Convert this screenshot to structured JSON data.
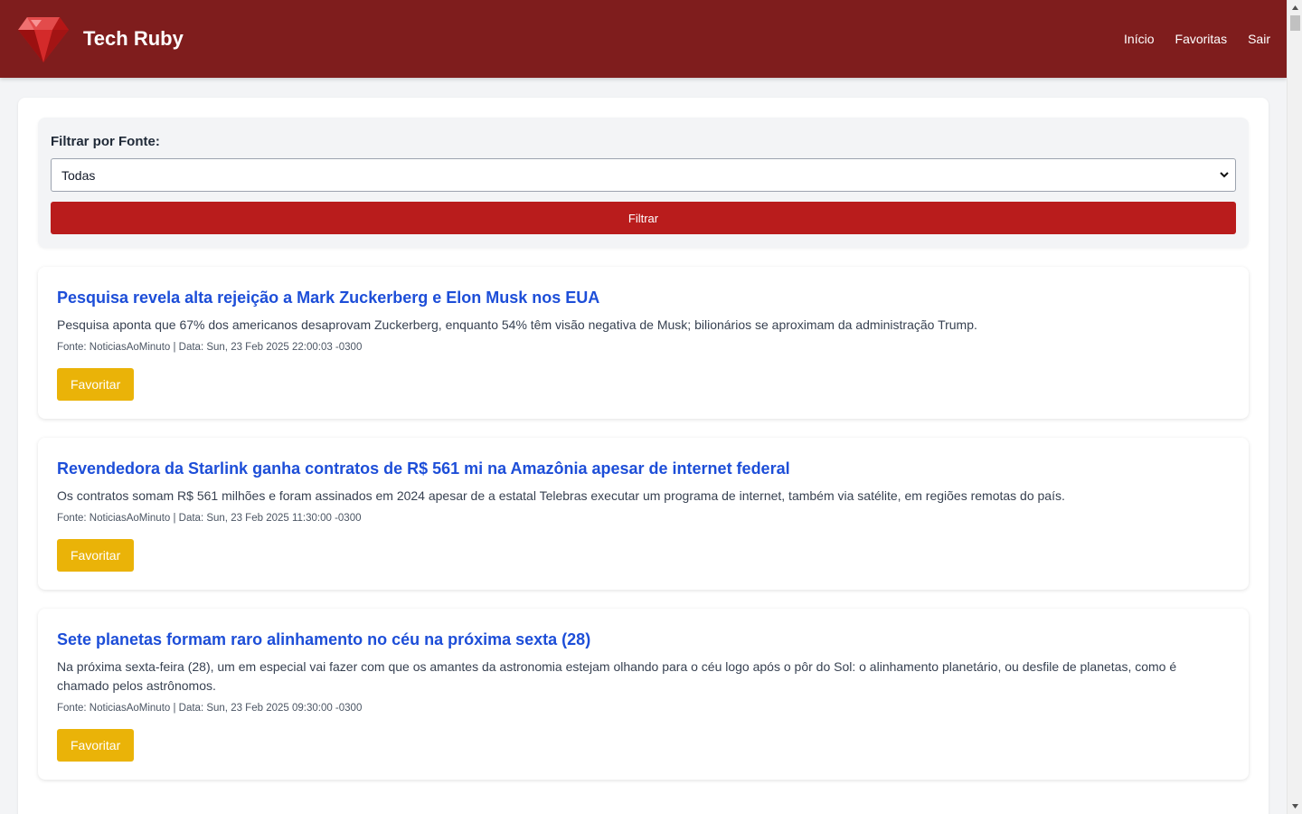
{
  "header": {
    "title": "Tech Ruby",
    "logo_icon": "ruby-gem-icon",
    "nav": [
      {
        "label": "Início"
      },
      {
        "label": "Favoritas"
      },
      {
        "label": "Sair"
      }
    ]
  },
  "filter": {
    "label": "Filtrar por Fonte:",
    "selected": "Todas",
    "button_label": "Filtrar"
  },
  "articles": [
    {
      "title": "Pesquisa revela alta rejeição a Mark Zuckerberg e Elon Musk nos EUA",
      "description": "Pesquisa aponta que 67% dos americanos desaprovam Zuckerberg, enquanto 54% têm visão negativa de Musk; bilionários se aproximam da administração Trump.",
      "meta": "Fonte: NoticiasAoMinuto | Data: Sun, 23 Feb 2025 22:00:03 -0300",
      "button_label": "Favoritar"
    },
    {
      "title": "Revendedora da Starlink ganha contratos de R$ 561 mi na Amazônia apesar de internet federal",
      "description": "Os contratos somam R$ 561 milhões e foram assinados em 2024 apesar de a estatal Telebras executar um programa de internet, também via satélite, em regiões remotas do país.",
      "meta": "Fonte: NoticiasAoMinuto | Data: Sun, 23 Feb 2025 11:30:00 -0300",
      "button_label": "Favoritar"
    },
    {
      "title": "Sete planetas formam raro alinhamento no céu na próxima sexta (28)",
      "description": "Na próxima sexta-feira (28), um em especial vai fazer com que os amantes da astronomia estejam olhando para o céu logo após o pôr do Sol: o alinhamento planetário, ou desfile de planetas, como é chamado pelos astrônomos.",
      "meta": "Fonte: NoticiasAoMinuto | Data: Sun, 23 Feb 2025 09:30:00 -0300",
      "button_label": "Favoritar"
    }
  ],
  "colors": {
    "header_bg": "#7f1d1d",
    "filter_button": "#b91c1c",
    "favorite_button": "#eab308",
    "title_link": "#1d4ed8"
  }
}
